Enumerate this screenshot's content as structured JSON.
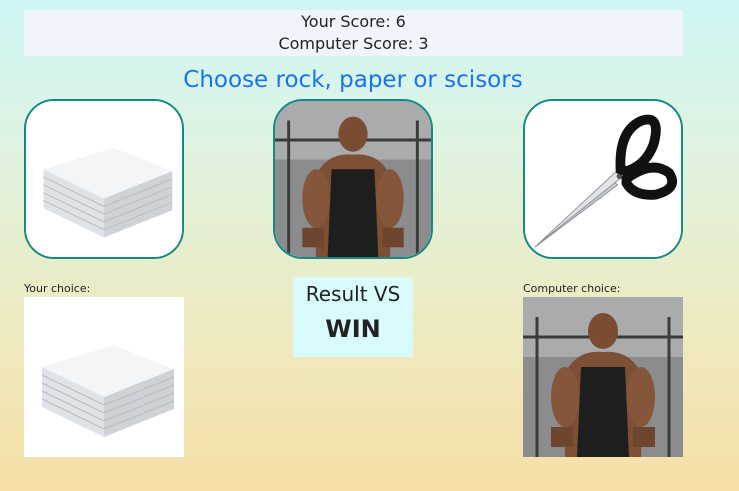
{
  "scoreboard": {
    "your_score": "Your Score: 6",
    "computer_score": "Computer Score: 3"
  },
  "prompt": "Choose rock, paper or scisors",
  "choices": [
    {
      "id": "paper",
      "icon": "paper-stack-icon"
    },
    {
      "id": "rock",
      "icon": "rock-photo-icon"
    },
    {
      "id": "scissors",
      "icon": "scissors-icon"
    }
  ],
  "your_choice_label": "Your choice:",
  "computer_choice_label": "Computer choice:",
  "result": {
    "title": "Result VS",
    "value": "WIN"
  },
  "colors": {
    "prompt": "#1a73e8",
    "button_border": "#138a85",
    "scoreboard_bg": "#eff5fb",
    "result_bg": "#d9fbfb"
  }
}
